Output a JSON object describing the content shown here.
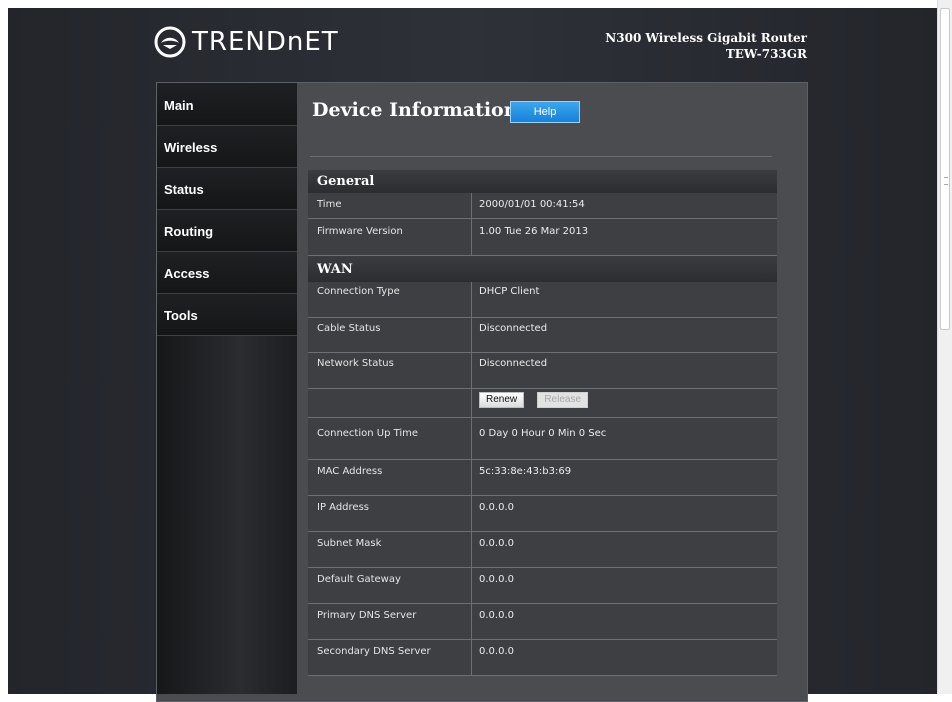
{
  "brand": {
    "logo_text": "TRENDnET",
    "product_name": "N300 Wireless Gigabit Router",
    "model": "TEW-733GR"
  },
  "nav": {
    "items": [
      "Main",
      "Wireless",
      "Status",
      "Routing",
      "Access",
      "Tools"
    ]
  },
  "page": {
    "title": "Device Information",
    "help_label": "Help"
  },
  "general": {
    "heading": "General",
    "rows": [
      {
        "label": "Time",
        "value": "2000/01/01 00:41:54"
      },
      {
        "label": "Firmware Version",
        "value": "1.00 Tue 26 Mar 2013"
      }
    ]
  },
  "wan": {
    "heading": "WAN",
    "rows_top": [
      {
        "label": "Connection Type",
        "value": "DHCP Client"
      },
      {
        "label": "Cable Status",
        "value": "Disconnected"
      },
      {
        "label": "Network Status",
        "value": "Disconnected"
      }
    ],
    "renew_label": "Renew",
    "release_label": "Release",
    "rows_bottom": [
      {
        "label": "Connection Up Time",
        "value": "0 Day 0 Hour 0 Min 0 Sec"
      },
      {
        "label": "MAC Address",
        "value": "5c:33:8e:43:b3:69"
      },
      {
        "label": "IP Address",
        "value": "0.0.0.0"
      },
      {
        "label": "Subnet Mask",
        "value": "0.0.0.0"
      },
      {
        "label": "Default Gateway",
        "value": "0.0.0.0"
      },
      {
        "label": "Primary DNS Server",
        "value": "0.0.0.0"
      },
      {
        "label": "Secondary DNS Server",
        "value": "0.0.0.0"
      }
    ]
  },
  "colors": {
    "help_button": "#1a87dc",
    "background": "#2b2e34"
  }
}
